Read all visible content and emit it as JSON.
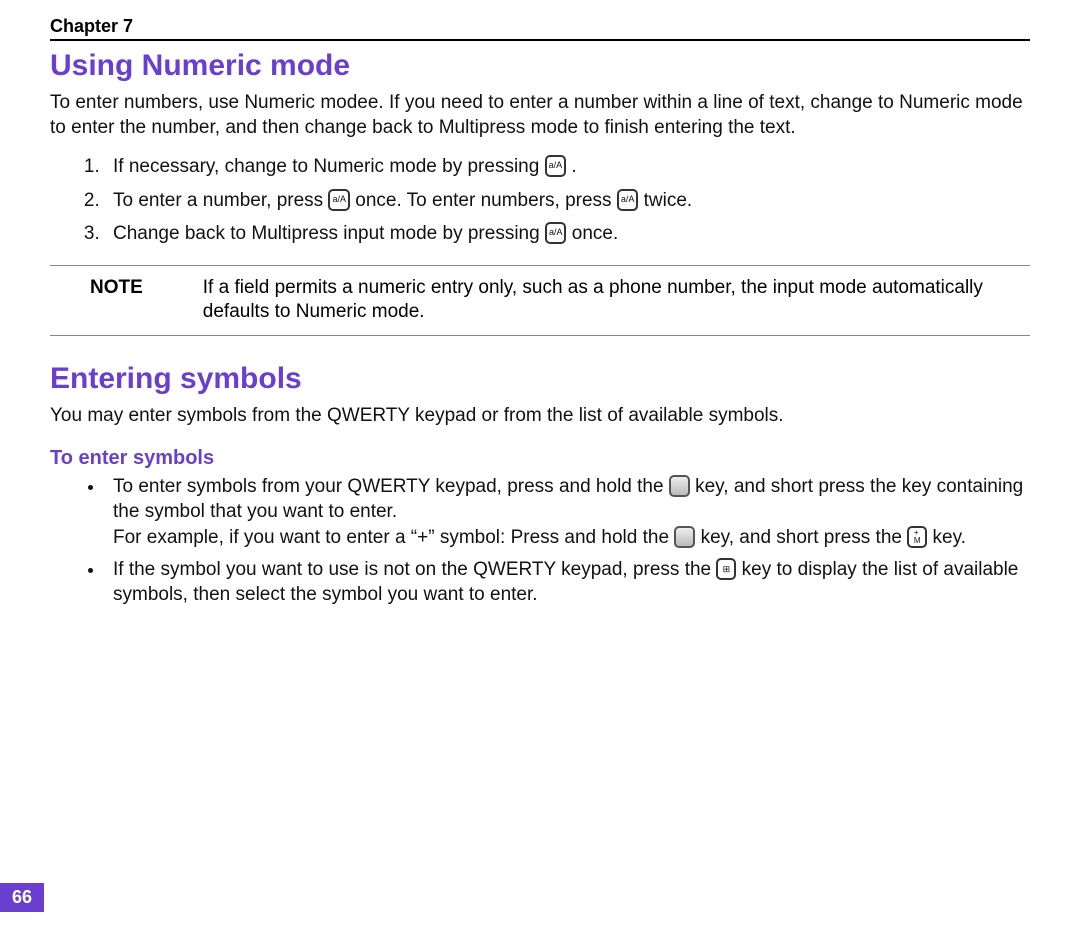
{
  "header": {
    "chapter": "Chapter 7"
  },
  "sections": {
    "numeric": {
      "title": "Using Numeric mode",
      "intro": "To enter numbers, use Numeric modee. If you need to enter a number within a line of text, change to Numeric mode to enter the number, and then change back to Multipress mode to finish entering the text.",
      "step1_a": "If necessary, change to Numeric mode by pressing ",
      "step1_b": ".",
      "step2_a": "To enter a number, press ",
      "step2_b": " once. To enter numbers, press ",
      "step2_c": " twice.",
      "step3_a": "Change back to Multipress input mode by pressing ",
      "step3_b": " once.",
      "note_label": "NOTE",
      "note_text": "If a field permits a numeric entry only, such as a phone number, the input mode automatically defaults to Numeric mode."
    },
    "symbols": {
      "title": "Entering symbols",
      "intro": "You may enter symbols from the QWERTY keypad or from the list of available symbols.",
      "sub": "To enter symbols",
      "b1_a": "To enter symbols from your QWERTY keypad, press and hold  the ",
      "b1_b": " key, and short press the key containing the symbol that you want to enter.",
      "b1_c": "For example, if you want to enter a “+” symbol: Press and hold the",
      "b1_d": " key, and short press the ",
      "b1_e": " key.",
      "b2_a": "If the symbol you want to use is not on the QWERTY keypad, press the ",
      "b2_b": " key to display the list of available symbols, then select the symbol you want to enter."
    }
  },
  "keys": {
    "aA": "a/A",
    "mplus_top": "+",
    "mplus_bottom": "M",
    "sym_glyph": "⊞"
  },
  "pageNumber": "66"
}
